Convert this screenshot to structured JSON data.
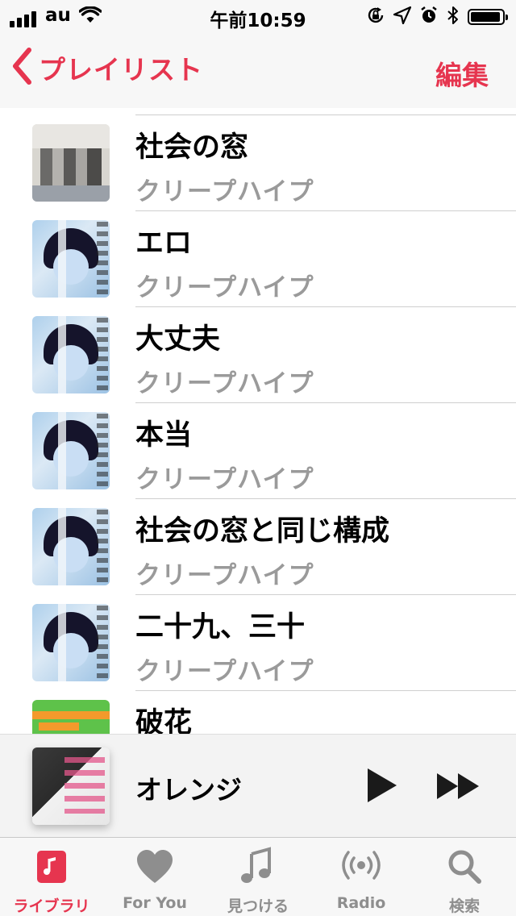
{
  "colors": {
    "accent": "#e6354f",
    "secondary_text": "#9a9a9a",
    "inactive_tab": "#8e8e8e"
  },
  "status_bar": {
    "carrier": "au",
    "time": "午前10:59",
    "icons": [
      "signal-icon",
      "wifi-icon",
      "rotation-lock-icon",
      "location-icon",
      "alarm-icon",
      "bluetooth-icon",
      "battery-icon"
    ]
  },
  "nav": {
    "back_label": "プレイリスト",
    "edit_label": "編集"
  },
  "songs": [
    {
      "title": "社会の窓",
      "artist": "クリープハイプ"
    },
    {
      "title": "エロ",
      "artist": "クリープハイプ"
    },
    {
      "title": "大丈夫",
      "artist": "クリープハイプ"
    },
    {
      "title": "本当",
      "artist": "クリープハイプ"
    },
    {
      "title": "社会の窓と同じ構成",
      "artist": "クリープハイプ"
    },
    {
      "title": "二十九、三十",
      "artist": "クリープハイプ"
    },
    {
      "title": "破花",
      "artist": ""
    }
  ],
  "now_playing": {
    "title": "オレンジ",
    "icons": [
      "play-icon",
      "fast-forward-icon"
    ]
  },
  "tabs": [
    {
      "label": "ライブラリ",
      "icon": "library-icon",
      "active": true
    },
    {
      "label": "For You",
      "icon": "heart-icon",
      "active": false
    },
    {
      "label": "見つける",
      "icon": "music-note-icon",
      "active": false
    },
    {
      "label": "Radio",
      "icon": "radio-icon",
      "active": false
    },
    {
      "label": "検索",
      "icon": "search-icon",
      "active": false
    }
  ]
}
